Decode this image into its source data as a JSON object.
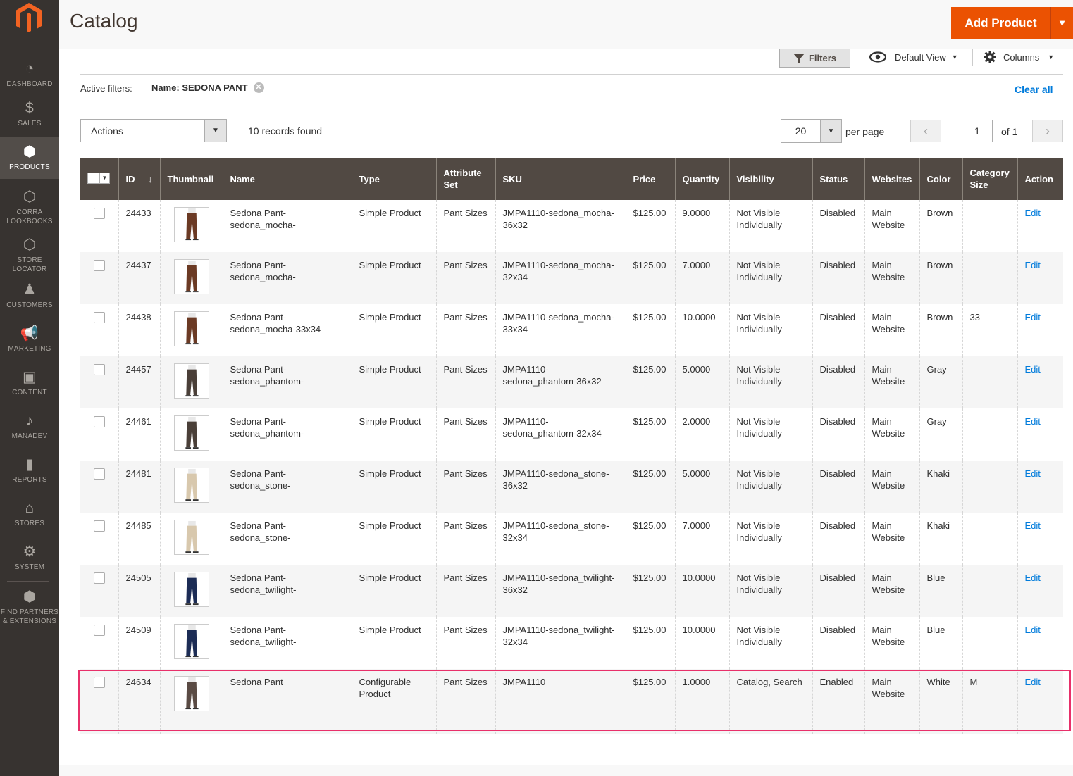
{
  "sidebar": {
    "items": [
      {
        "label": "DASHBOARD",
        "icon": "dashboard-icon"
      },
      {
        "label": "SALES",
        "icon": "dollar-icon"
      },
      {
        "label": "PRODUCTS",
        "icon": "cube-icon"
      },
      {
        "label": "CORRA LOOKBOOKS",
        "icon": "hexagon-icon"
      },
      {
        "label": "STORE LOCATOR",
        "icon": "hexagon-icon"
      },
      {
        "label": "CUSTOMERS",
        "icon": "person-icon"
      },
      {
        "label": "MARKETING",
        "icon": "megaphone-icon"
      },
      {
        "label": "CONTENT",
        "icon": "layout-icon"
      },
      {
        "label": "MANADEV",
        "icon": "music-note-icon"
      },
      {
        "label": "REPORTS",
        "icon": "bar-chart-icon"
      },
      {
        "label": "STORES",
        "icon": "storefront-icon"
      },
      {
        "label": "SYSTEM",
        "icon": "gear-icon"
      },
      {
        "label": "FIND PARTNERS & EXTENSIONS",
        "icon": "box-icon"
      }
    ],
    "active": "PRODUCTS"
  },
  "header": {
    "title": "Catalog",
    "add_button": "Add Product"
  },
  "toolbar": {
    "filters": "Filters",
    "view": "Default View",
    "columns": "Columns"
  },
  "active_filters": {
    "label": "Active filters:",
    "chip": "Name: SEDONA PANT",
    "clear_all": "Clear all"
  },
  "actions": {
    "label": "Actions",
    "records": "10 records found"
  },
  "pager": {
    "per_page_value": "20",
    "per_page_label": "per page",
    "page": "1",
    "of": "of 1"
  },
  "grid": {
    "columns": [
      "ID",
      "Thumbnail",
      "Name",
      "Type",
      "Attribute Set",
      "SKU",
      "Price",
      "Quantity",
      "Visibility",
      "Status",
      "Websites",
      "Color",
      "Category Size",
      "Action"
    ],
    "rows": [
      {
        "id": "24433",
        "name": "Sedona Pant-sedona_mocha-",
        "type": "Simple Product",
        "attr": "Pant Sizes",
        "sku": "JMPA1110-sedona_mocha-36x32",
        "price": "$125.00",
        "qty": "9.0000",
        "visibility": "Not Visible Individually",
        "status": "Disabled",
        "websites": "Main Website",
        "color": "Brown",
        "size": "",
        "action": "Edit",
        "pant_color": "#6b3a24"
      },
      {
        "id": "24437",
        "name": "Sedona Pant-sedona_mocha-",
        "type": "Simple Product",
        "attr": "Pant Sizes",
        "sku": "JMPA1110-sedona_mocha-32x34",
        "price": "$125.00",
        "qty": "7.0000",
        "visibility": "Not Visible Individually",
        "status": "Disabled",
        "websites": "Main Website",
        "color": "Brown",
        "size": "",
        "action": "Edit",
        "pant_color": "#6b3a24"
      },
      {
        "id": "24438",
        "name": "Sedona Pant-sedona_mocha-33x34",
        "type": "Simple Product",
        "attr": "Pant Sizes",
        "sku": "JMPA1110-sedona_mocha-33x34",
        "price": "$125.00",
        "qty": "10.0000",
        "visibility": "Not Visible Individually",
        "status": "Disabled",
        "websites": "Main Website",
        "color": "Brown",
        "size": "33",
        "action": "Edit",
        "pant_color": "#6b3a24"
      },
      {
        "id": "24457",
        "name": "Sedona Pant-sedona_phantom-",
        "type": "Simple Product",
        "attr": "Pant Sizes",
        "sku": "JMPA1110-sedona_phantom-36x32",
        "price": "$125.00",
        "qty": "5.0000",
        "visibility": "Not Visible Individually",
        "status": "Disabled",
        "websites": "Main Website",
        "color": "Gray",
        "size": "",
        "action": "Edit",
        "pant_color": "#4a3f38"
      },
      {
        "id": "24461",
        "name": "Sedona Pant-sedona_phantom-",
        "type": "Simple Product",
        "attr": "Pant Sizes",
        "sku": "JMPA1110-sedona_phantom-32x34",
        "price": "$125.00",
        "qty": "2.0000",
        "visibility": "Not Visible Individually",
        "status": "Disabled",
        "websites": "Main Website",
        "color": "Gray",
        "size": "",
        "action": "Edit",
        "pant_color": "#4a3f38"
      },
      {
        "id": "24481",
        "name": "Sedona Pant-sedona_stone-",
        "type": "Simple Product",
        "attr": "Pant Sizes",
        "sku": "JMPA1110-sedona_stone-36x32",
        "price": "$125.00",
        "qty": "5.0000",
        "visibility": "Not Visible Individually",
        "status": "Disabled",
        "websites": "Main Website",
        "color": "Khaki",
        "size": "",
        "action": "Edit",
        "pant_color": "#d8c8ad"
      },
      {
        "id": "24485",
        "name": "Sedona Pant-sedona_stone-",
        "type": "Simple Product",
        "attr": "Pant Sizes",
        "sku": "JMPA1110-sedona_stone-32x34",
        "price": "$125.00",
        "qty": "7.0000",
        "visibility": "Not Visible Individually",
        "status": "Disabled",
        "websites": "Main Website",
        "color": "Khaki",
        "size": "",
        "action": "Edit",
        "pant_color": "#d8c8ad"
      },
      {
        "id": "24505",
        "name": "Sedona Pant-sedona_twilight-",
        "type": "Simple Product",
        "attr": "Pant Sizes",
        "sku": "JMPA1110-sedona_twilight-36x32",
        "price": "$125.00",
        "qty": "10.0000",
        "visibility": "Not Visible Individually",
        "status": "Disabled",
        "websites": "Main Website",
        "color": "Blue",
        "size": "",
        "action": "Edit",
        "pant_color": "#1c2c55"
      },
      {
        "id": "24509",
        "name": "Sedona Pant-sedona_twilight-",
        "type": "Simple Product",
        "attr": "Pant Sizes",
        "sku": "JMPA1110-sedona_twilight-32x34",
        "price": "$125.00",
        "qty": "10.0000",
        "visibility": "Not Visible Individually",
        "status": "Disabled",
        "websites": "Main Website",
        "color": "Blue",
        "size": "",
        "action": "Edit",
        "pant_color": "#1c2c55"
      },
      {
        "id": "24634",
        "name": "Sedona Pant",
        "type": "Configurable Product",
        "attr": "Pant Sizes",
        "sku": "JMPA1110",
        "price": "$125.00",
        "qty": "1.0000",
        "visibility": "Catalog, Search",
        "status": "Enabled",
        "websites": "Main Website",
        "color": "White",
        "size": "M",
        "action": "Edit",
        "pant_color": "#5a4b44"
      }
    ]
  },
  "colors": {
    "accent": "#eb5202",
    "sidebar": "#373330",
    "grid_header": "#514943",
    "link": "#007bdb",
    "highlight": "#e8306a"
  }
}
